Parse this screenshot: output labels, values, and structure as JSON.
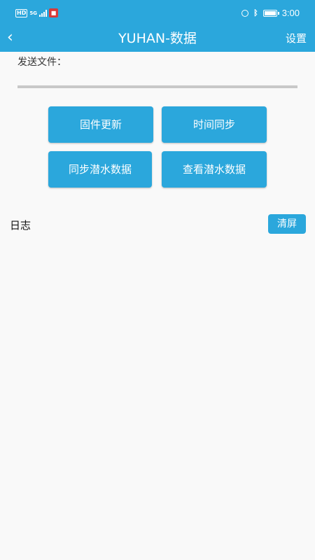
{
  "status_bar": {
    "hd": "HD",
    "network": "5G",
    "time": "3:00",
    "icons": [
      "hd-icon",
      "signal-icon",
      "app-notification-icon",
      "alarm-icon",
      "bluetooth-icon",
      "battery-icon"
    ]
  },
  "app_bar": {
    "back_icon": "‹",
    "title": "YUHAN-数据",
    "settings_label": "设置"
  },
  "send_file": {
    "label": "发送文件：",
    "value": "",
    "placeholder": ""
  },
  "buttons": {
    "firmware_update": "固件更新",
    "time_sync": "时间同步",
    "sync_dive_data": "同步潜水数据",
    "view_dive_data": "查看潜水数据"
  },
  "log": {
    "label": "日志",
    "clear_label": "清屏",
    "content": ""
  },
  "colors": {
    "accent": "#2ba7dc",
    "background": "#f9f9f9",
    "input_underline": "#c8c8c8"
  }
}
